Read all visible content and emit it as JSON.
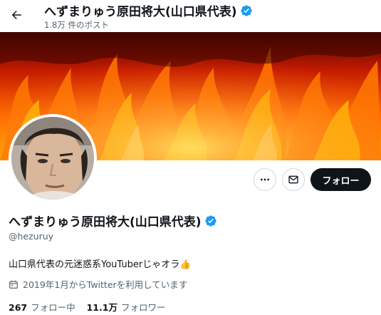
{
  "header": {
    "title": "へずまりゅう原田将大(山口県代表)",
    "post_count": "1.8万 件のポスト"
  },
  "profile": {
    "name": "へずまりゅう原田将大(山口県代表)",
    "handle": "@hezuruy",
    "bio": "山口県代表の元迷惑系YouTuberじゃオラ👍",
    "joined": "2019年1月からTwitterを利用しています",
    "following_count": "267",
    "following_label": "フォロー中",
    "followers_count": "11.1万",
    "followers_label": "フォロワー"
  },
  "actions": {
    "follow_label": "フォロー"
  },
  "colors": {
    "verified": "#1d9bf0",
    "follow_button": "#0f1419",
    "secondary_text": "#536471"
  },
  "icons": [
    "back-arrow-icon",
    "verified-badge-icon",
    "more-icon",
    "message-icon",
    "calendar-icon"
  ]
}
